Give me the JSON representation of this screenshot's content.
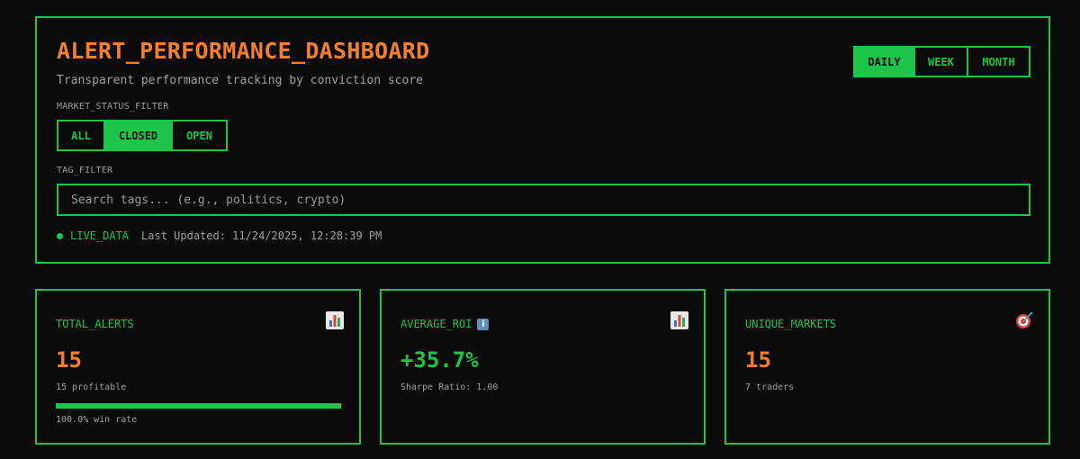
{
  "header": {
    "title": "ALERT_PERFORMANCE_DASHBOARD",
    "subtitle": "Transparent performance tracking by conviction score"
  },
  "period_filter": {
    "options": [
      "DAILY",
      "WEEK",
      "MONTH"
    ],
    "selected": "DAILY"
  },
  "market_status_filter": {
    "label": "MARKET_STATUS_FILTER",
    "options": [
      "ALL",
      "CLOSED",
      "OPEN"
    ],
    "selected": "CLOSED"
  },
  "tag_filter": {
    "label": "TAG_FILTER",
    "placeholder": "Search tags... (e.g., politics, crypto)",
    "value": ""
  },
  "status": {
    "live_label": "LIVE_DATA",
    "last_updated": "Last Updated: 11/24/2025, 12:28:39 PM"
  },
  "cards": {
    "total_alerts": {
      "label": "TOTAL_ALERTS",
      "icon": "bar-chart-icon",
      "value": "15",
      "sub": "15 profitable",
      "win_rate_fraction": 1.0,
      "foot": "100.0% win rate"
    },
    "average_roi": {
      "label": "AVERAGE_ROI",
      "info_icon": "info-icon",
      "icon": "bar-chart-icon",
      "value": "+35.7%",
      "sub": "Sharpe Ratio: 1.00"
    },
    "unique_markets": {
      "label": "UNIQUE_MARKETS",
      "icon": "target-icon",
      "value": "15",
      "sub": "7 traders"
    }
  },
  "colors": {
    "background": "#0b0b0b",
    "accent_green": "#1ec449",
    "accent_orange": "#f47f2c",
    "muted_text": "#a0a0a0"
  }
}
